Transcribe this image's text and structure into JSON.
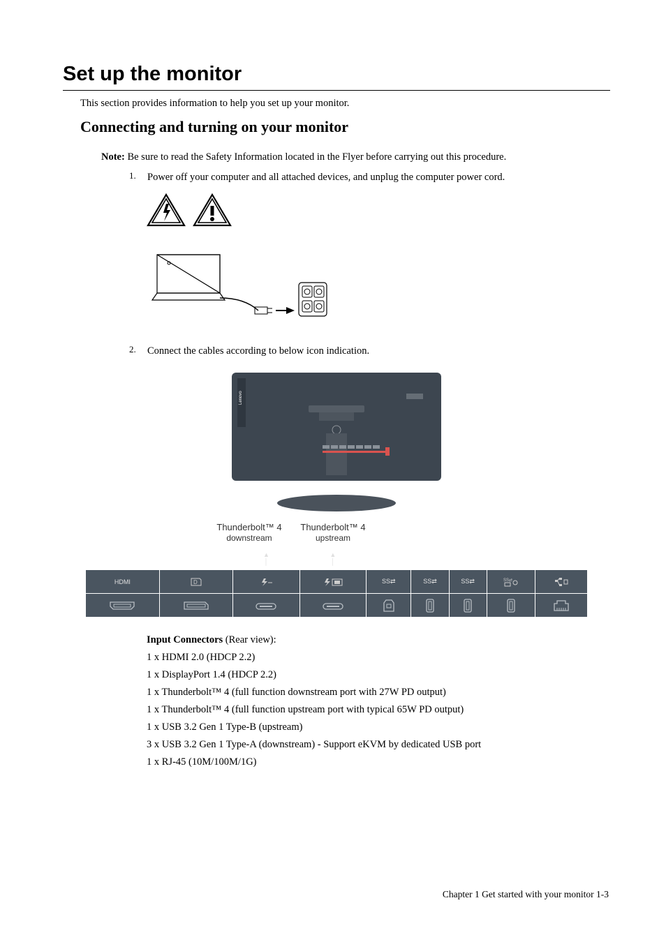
{
  "heading1": "Set up the monitor",
  "intro": "This section provides information to help you set up your monitor.",
  "heading2": "Connecting and turning on your monitor",
  "note_label": "Note:",
  "note_text": " Be sure to read the Safety Information located in the Flyer before carrying out this procedure.",
  "step1_num": "1.",
  "step1_text": "Power off your computer and all attached devices, and unplug the computer power cord.",
  "step2_num": "2.",
  "step2_text": "Connect the cables according to below icon indication.",
  "tb_down_line1": "Thunderbolt™ 4",
  "tb_down_line2": "downstream",
  "tb_up_line1": "Thunderbolt™ 4",
  "tb_up_line2": "upstream",
  "port_labels": [
    "HDMI",
    "D",
    "",
    "",
    "SS⇄",
    "SS⇄",
    "SS⇄",
    "SS⇄",
    ""
  ],
  "connectors_title": "Input Connectors",
  "connectors_suffix": " (Rear view):",
  "conn_list": [
    "1 x HDMI 2.0 (HDCP 2.2)",
    "1 x DisplayPort 1.4 (HDCP 2.2)",
    "1 x Thunderbolt™ 4 (full function downstream port with 27W PD output)",
    "1 x Thunderbolt™ 4 (full function upstream port with typical 65W PD output)",
    "1 x USB 3.2 Gen 1 Type-B (upstream)",
    "3 x USB 3.2 Gen 1 Type-A (downstream) - Support eKVM by dedicated USB port",
    "1 x RJ-45 (10M/100M/1G)"
  ],
  "footer": "Chapter 1 Get started with your monitor  1-3"
}
